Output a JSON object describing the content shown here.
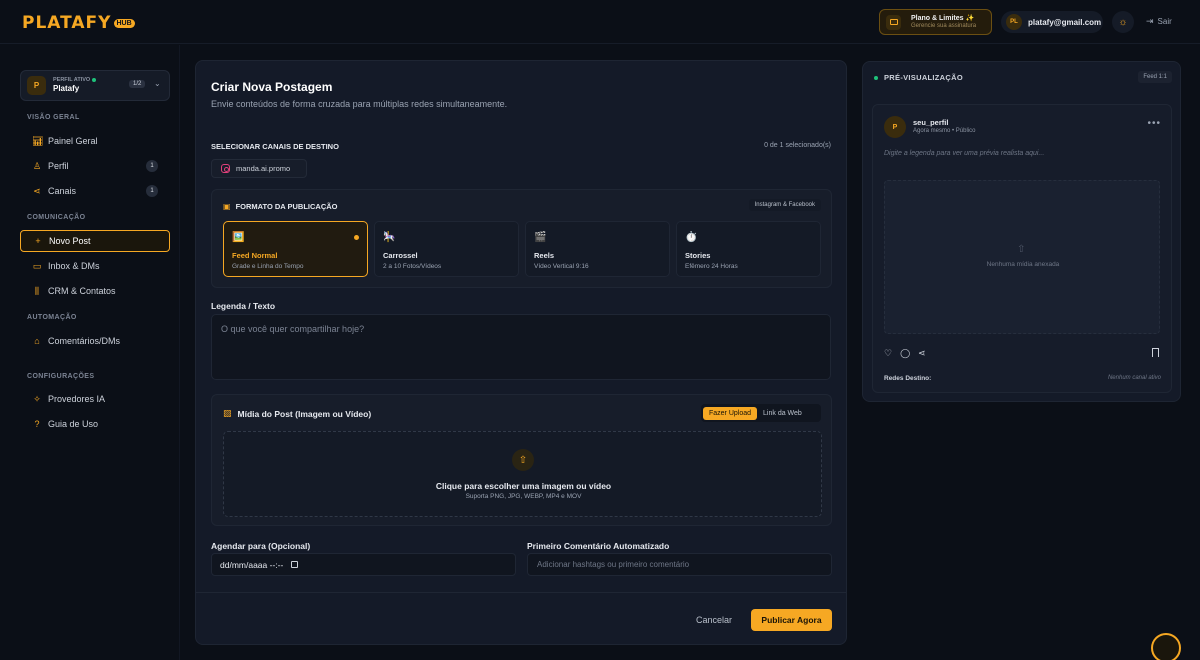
{
  "header": {
    "logo_text": "PLATAFY",
    "logo_badge": "HUB",
    "plan": {
      "title": "Plano & Limites",
      "title_icon": "✨",
      "subtitle": "Gerencie sua assinatura"
    },
    "user": {
      "initials": "PL",
      "email": "platafy@gmail.com"
    },
    "logout_label": "Sair"
  },
  "sidebar": {
    "profile": {
      "tag": "PERFIL ATIVO",
      "name": "Platafy",
      "initial": "P",
      "count": "1/2"
    },
    "sections": [
      {
        "label": "VISÃO GERAL"
      },
      {
        "label": "COMUNICAÇÃO"
      },
      {
        "label": "AUTOMAÇÃO"
      },
      {
        "label": "CONFIGURAÇÕES"
      }
    ],
    "items": [
      {
        "label": "Painel Geral",
        "icon": "bar-chart-icon"
      },
      {
        "label": "Perfil",
        "icon": "user-icon",
        "badge": "1"
      },
      {
        "label": "Canais",
        "icon": "share-icon",
        "badge": "1"
      },
      {
        "label": "Novo Post",
        "icon": "plus-icon"
      },
      {
        "label": "Inbox & DMs",
        "icon": "message-icon"
      },
      {
        "label": "CRM & Contatos",
        "icon": "kanban-icon"
      },
      {
        "label": "Comentários/DMs",
        "icon": "bot-icon"
      },
      {
        "label": "Provedores IA",
        "icon": "sparkle-icon"
      },
      {
        "label": "Guia de Uso",
        "icon": "help-icon"
      }
    ]
  },
  "main": {
    "title": "Criar Nova Postagem",
    "subtitle": "Envie conteúdos de forma cruzada para múltiplas redes simultaneamente.",
    "channels": {
      "label": "SELECIONAR CANAIS DE DESTINO",
      "count": "0 de 1 selecionado(s)",
      "chip": "manda.ai.promo"
    },
    "format": {
      "title": "FORMATO DA PUBLICAÇÃO",
      "tag": "Instagram & Facebook",
      "options": [
        {
          "emoji": "🖼️",
          "title": "Feed Normal",
          "sub": "Grade e Linha do Tempo",
          "selected": true
        },
        {
          "emoji": "🎠",
          "title": "Carrossel",
          "sub": "2 a 10 Fotos/Vídeos"
        },
        {
          "emoji": "🎬",
          "title": "Reels",
          "sub": "Vídeo Vertical 9:16"
        },
        {
          "emoji": "⏱️",
          "title": "Stories",
          "sub": "Efêmero 24 Horas"
        }
      ]
    },
    "caption": {
      "label": "Legenda / Texto",
      "placeholder": "O que você quer compartilhar hoje?"
    },
    "media": {
      "title": "Mídia do Post (Imagem ou Vídeo)",
      "toggle_upload": "Fazer Upload",
      "toggle_link": "Link da Web",
      "dz_title": "Clique para escolher uma imagem ou vídeo",
      "dz_sub": "Suporta PNG, JPG, WEBP, MP4 e MOV"
    },
    "schedule": {
      "label": "Agendar para (Opcional)",
      "value": "dd/mm/aaaa --:--"
    },
    "first_comment": {
      "label": "Primeiro Comentário Automatizado",
      "placeholder": "Adicionar hashtags ou primeiro comentário"
    },
    "cancel_label": "Cancelar",
    "publish_label": "Publicar Agora"
  },
  "preview": {
    "title": "PRÉ-VISUALIZAÇÃO",
    "tag": "Feed 1:1",
    "user": "seu_perfil",
    "initial": "P",
    "meta": "Agora mesmo • Público",
    "caption_placeholder": "Digite a legenda para ver uma prévia realista aqui...",
    "no_media": "Nenhuma mídia anexada",
    "dest_label": "Redes Destino:",
    "dest_value": "Nenhum canal ativo"
  },
  "colors": {
    "accent": "#f6a823",
    "background": "#0b0f17",
    "card": "#141a28",
    "online": "#1ec27a"
  }
}
